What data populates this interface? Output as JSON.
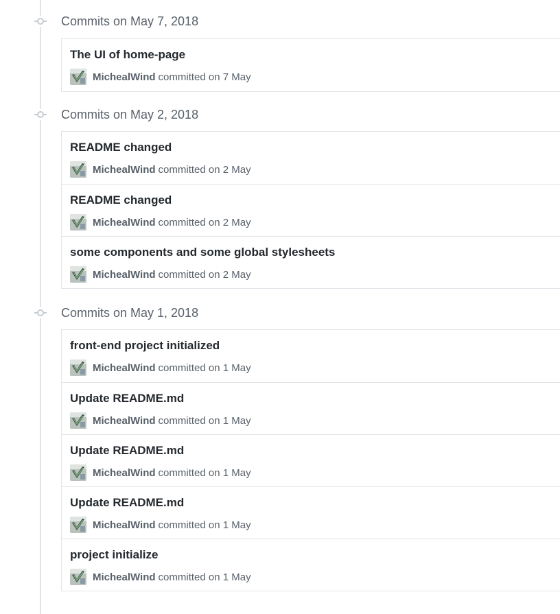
{
  "groups": [
    {
      "title": "Commits on May 7, 2018",
      "commits": [
        {
          "title": "The UI of home-page",
          "author": "MichealWind",
          "meta": "committed on 7 May"
        }
      ]
    },
    {
      "title": "Commits on May 2, 2018",
      "commits": [
        {
          "title": "README changed",
          "author": "MichealWind",
          "meta": "committed on 2 May"
        },
        {
          "title": "README changed",
          "author": "MichealWind",
          "meta": "committed on 2 May"
        },
        {
          "title": "some components and some global stylesheets",
          "author": "MichealWind",
          "meta": "committed on 2 May"
        }
      ]
    },
    {
      "title": "Commits on May 1, 2018",
      "commits": [
        {
          "title": "front-end project initialized",
          "author": "MichealWind",
          "meta": "committed on 1 May"
        },
        {
          "title": "Update README.md",
          "author": "MichealWind",
          "meta": "committed on 1 May"
        },
        {
          "title": "Update README.md",
          "author": "MichealWind",
          "meta": "committed on 1 May"
        },
        {
          "title": "Update README.md",
          "author": "MichealWind",
          "meta": "committed on 1 May"
        },
        {
          "title": "project initialize",
          "author": "MichealWind",
          "meta": "committed on 1 May"
        }
      ]
    }
  ],
  "icons": {
    "group_marker": "git-commit-icon",
    "avatar": "user-avatar"
  },
  "colors": {
    "timeline": "#e1e4e8",
    "muted_text": "#586069",
    "title_text": "#24292e",
    "border": "#e1e4e8"
  }
}
